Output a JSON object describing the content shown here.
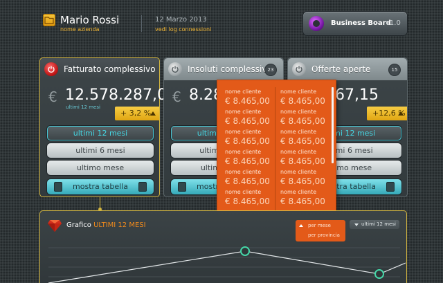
{
  "header": {
    "user_name": "Mario Rossi",
    "company": "nome azienda",
    "date": "12 Marzo 2013",
    "log_link": "vedi log connessioni",
    "brand_name": "Business Board",
    "brand_version": "v1.0"
  },
  "cards": [
    {
      "title": "Fatturato complessivo",
      "currency": "€",
      "amount": "12.578.287,09",
      "period": "ultimi 12 mesi",
      "delta": "+ 3,2 %",
      "options": [
        "ultimi 12 mesi",
        "ultimi 6 mesi",
        "ultimo mese"
      ],
      "table_button": "mostra tabella"
    },
    {
      "title": "Insoluti complessivi",
      "count": "23",
      "currency": "€",
      "amount": "8.28",
      "options": [
        "ultimi 12 mesi",
        "ultimi 6 mesi",
        "ultimo mese"
      ],
      "table_button": "mostra tabella"
    },
    {
      "title": "Offerte aperte",
      "count": "15",
      "amount": "67,15",
      "delta": "+12,6 %",
      "options": [
        "ultimi 12 mesi",
        "ultimi 6 mesi",
        "ultimo mese"
      ],
      "table_button": "mostra tabella"
    }
  ],
  "popup": {
    "entries": [
      {
        "name": "nome cliente",
        "amount": "€ 8.465,00"
      },
      {
        "name": "nome cliente",
        "amount": "€ 8.465,00"
      },
      {
        "name": "nome cliente",
        "amount": "€ 8.465,00"
      },
      {
        "name": "nome cliente",
        "amount": "€ 8.465,00"
      },
      {
        "name": "nome cliente",
        "amount": "€ 8.465,00"
      },
      {
        "name": "nome cliente",
        "amount": "€ 8.465,00"
      },
      {
        "name": "nome cliente",
        "amount": "€ 8.465,00"
      },
      {
        "name": "nome cliente",
        "amount": "€ 8.465,00"
      },
      {
        "name": "nome cliente",
        "amount": "€ 8.465,00"
      },
      {
        "name": "nome cliente",
        "amount": "€ 8.465,00"
      },
      {
        "name": "nome cliente",
        "amount": "€ 8.465,00"
      },
      {
        "name": "nome cliente",
        "amount": "€ 8.465,00"
      }
    ]
  },
  "chart": {
    "title": "Grafico",
    "title_highlight": "ULTIMI 12 MESI",
    "filter_options": [
      "per mese",
      "per provincia"
    ],
    "range_selected": "ultimi 12 mesi"
  },
  "colors": {
    "accent_gold": "#d2b540",
    "accent_orange": "#e35a19",
    "accent_cyan": "#45d7e4",
    "positive_badge": "#f0c030"
  },
  "icons": {
    "user": "folder-icon",
    "brand": "business-board-logo-icon",
    "card_header": "power-icon",
    "chart": "ruby-gem-icon"
  }
}
